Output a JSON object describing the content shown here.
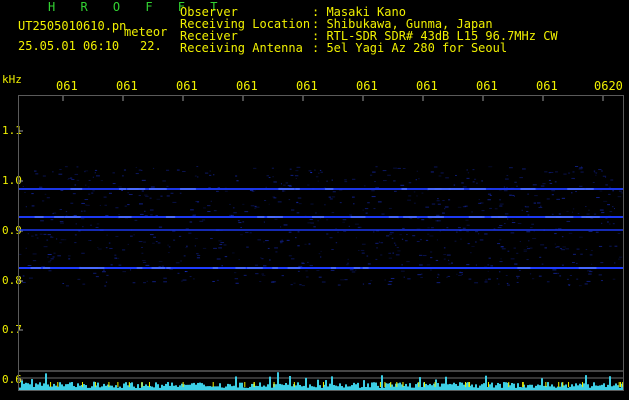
{
  "header": {
    "brand": "H R O F F T",
    "filename": "UT2505010610.pn",
    "tag": "meteor",
    "datetime": "25.05.01 06:10",
    "count": "22."
  },
  "info": {
    "observer_label": "Observer",
    "observer_value": ": Masaki Kano",
    "location_label": "Receiving Location",
    "location_value": ": Shibukawa, Gunma, Japan",
    "receiver_label": "Receiver",
    "receiver_value": ": RTL-SDR SDR# 43dB L15 96.7MHz CW",
    "antenna_label": "Receiving Antenna",
    "antenna_value": ": 5el Yagi Az 280 for Seoul"
  },
  "axis": {
    "y_unit": "kHz",
    "y_ticks": [
      "1.1",
      "1.0",
      "0.9",
      "0.8",
      "0.7",
      "0.6"
    ],
    "x_ticks": [
      "061",
      "061",
      "061",
      "061",
      "061",
      "061",
      "061",
      "061",
      "061",
      "0620"
    ]
  },
  "colors": {
    "label_yellow": "#f0f000",
    "brand_green": "#32d232",
    "signal_blue": "#1e3cff",
    "noise_cyan": "#3ccfe6"
  }
}
